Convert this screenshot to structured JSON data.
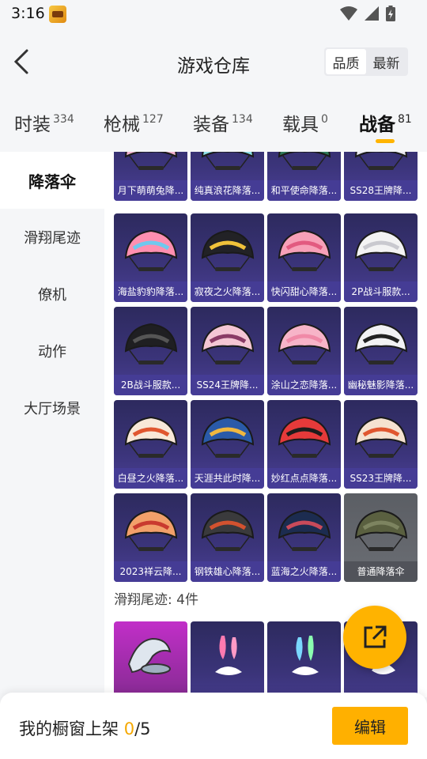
{
  "status_bar": {
    "time": "3:16"
  },
  "header": {
    "title": "游戏仓库",
    "sort_options": [
      "品质",
      "最新"
    ]
  },
  "category_tabs": [
    {
      "label": "时装",
      "count": "334"
    },
    {
      "label": "枪械",
      "count": "127"
    },
    {
      "label": "装备",
      "count": "134"
    },
    {
      "label": "载具",
      "count": "0"
    },
    {
      "label": "战备",
      "count": "81",
      "active": true
    }
  ],
  "sidebar": {
    "items": [
      {
        "label": "降落伞",
        "active": true
      },
      {
        "label": "滑翔尾迹"
      },
      {
        "label": "僚机"
      },
      {
        "label": "动作"
      },
      {
        "label": "大厅场景"
      }
    ]
  },
  "items": [
    {
      "name": "月下萌萌兔降...",
      "colors": [
        "#f2b4cf",
        "#e66fa8"
      ]
    },
    {
      "name": "纯真浪花降落...",
      "colors": [
        "#8fe0e8",
        "#f7df5a"
      ]
    },
    {
      "name": "和平使命降落...",
      "colors": [
        "#2f7a5a",
        "#7dc7a0"
      ]
    },
    {
      "name": "SS28王牌降...",
      "colors": [
        "#e8e8f0",
        "#8a6be0"
      ]
    },
    {
      "name": "海盐豹豹降落...",
      "colors": [
        "#ff8fb0",
        "#6fc8ee"
      ]
    },
    {
      "name": "寂夜之火降落...",
      "colors": [
        "#222226",
        "#f0c23a"
      ]
    },
    {
      "name": "快闪甜心降落...",
      "colors": [
        "#f7a0b8",
        "#e25a80"
      ]
    },
    {
      "name": "2P战斗服款...",
      "colors": [
        "#f3f3f3",
        "#c9c9cf"
      ]
    },
    {
      "name": "2B战斗服款...",
      "colors": [
        "#1f1f22",
        "#555"
      ]
    },
    {
      "name": "SS24王牌降...",
      "colors": [
        "#f4c6d4",
        "#8a3b66"
      ]
    },
    {
      "name": "涂山之恋降落...",
      "colors": [
        "#f7b4c8",
        "#f08aa8"
      ]
    },
    {
      "name": "幽秘魅影降落...",
      "colors": [
        "#f2f2f4",
        "#222"
      ]
    },
    {
      "name": "白昼之火降落...",
      "colors": [
        "#f8e8d8",
        "#e0562f"
      ]
    },
    {
      "name": "天涯共此时降...",
      "colors": [
        "#2a5aa8",
        "#f0b840"
      ]
    },
    {
      "name": "妙红点点降落...",
      "colors": [
        "#e53a3a",
        "#1c1c1c"
      ]
    },
    {
      "name": "SS23王牌降...",
      "colors": [
        "#f5e2d0",
        "#e0562f"
      ]
    },
    {
      "name": "2023祥云降...",
      "colors": [
        "#f2a06a",
        "#c93a2f"
      ]
    },
    {
      "name": "钢铁雄心降落...",
      "colors": [
        "#3a3a3c",
        "#d2522f"
      ]
    },
    {
      "name": "蓝海之火降落...",
      "colors": [
        "#1c2c50",
        "#c84a5a"
      ]
    },
    {
      "name": "普通降落伞",
      "colors": [
        "#5a6040",
        "#7d8460"
      ],
      "plain": true
    }
  ],
  "trail_section": {
    "label": "滑翔尾迹: 4件"
  },
  "bottom_bar": {
    "label": "我的橱窗上架",
    "current": "0",
    "total": "/5",
    "edit_label": "编辑"
  },
  "accent_color": "#ffb000"
}
